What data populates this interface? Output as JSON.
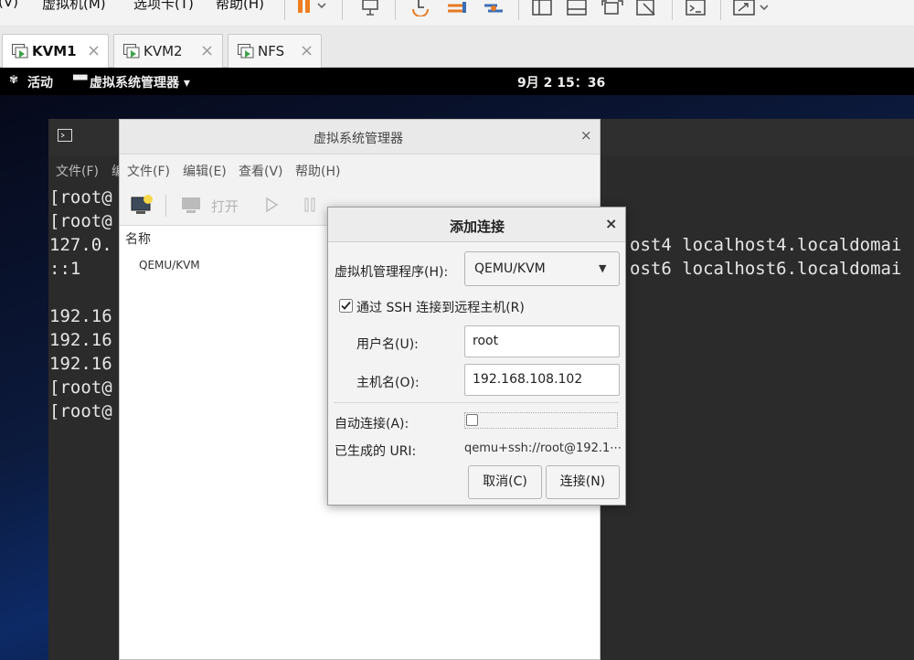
{
  "host": {
    "menubar": {
      "view": "(V)",
      "vm": "虚拟机(M)",
      "tabs": "选项卡(T)",
      "help": "帮助(H)"
    },
    "tabs": [
      {
        "label": "KVM1",
        "active": true
      },
      {
        "label": "KVM2",
        "active": false
      },
      {
        "label": "NFS",
        "active": false
      }
    ],
    "tab_close_glyph": "×"
  },
  "gnome": {
    "activities": "活动",
    "app_menu": "虚拟系统管理器 ▾",
    "clock": "9月 2  15：36"
  },
  "terminal": {
    "menu_file": "文件(F)",
    "menu_cut": "编",
    "lines": [
      "[root@",
      "[root@",
      "127.0.",
      "::1",
      "",
      "192.16",
      "192.16",
      "192.16",
      "[root@",
      "[root@"
    ],
    "right_lines": [
      "ost4 localhost4.localdomai",
      "ost6 localhost6.localdomai"
    ]
  },
  "vmm": {
    "title": "虚拟系统管理器",
    "close": "×",
    "menu": {
      "file": "文件(F)",
      "edit": "编辑(E)",
      "view": "查看(V)",
      "help": "帮助(H)"
    },
    "toolbar": {
      "open": "打开"
    },
    "list_header": "名称",
    "connections": [
      "QEMU/KVM"
    ]
  },
  "dialog": {
    "title": "添加连接",
    "close": "×",
    "hypervisor_label": "虚拟机管理程序(H):",
    "hypervisor_value": "QEMU/KVM",
    "ssh_label": "通过 SSH 连接到远程主机(R)",
    "ssh_checked": true,
    "username_label": "用户名(U):",
    "username_value": "root",
    "hostname_label": "主机名(O):",
    "hostname_value": "192.168.108.102",
    "autoconnect_label": "自动连接(A):",
    "autoconnect_checked": false,
    "uri_label": "已生成的 URI:",
    "uri_value": "qemu+ssh://root@192.1⋯",
    "cancel_label": "取消(C)",
    "connect_label": "连接(N)"
  },
  "colors": {
    "accent_green": "#3ea34a",
    "accent_orange": "#e67a22",
    "pause_orange": "#f07d1e",
    "terminal_bg": "#2b2b2b"
  }
}
